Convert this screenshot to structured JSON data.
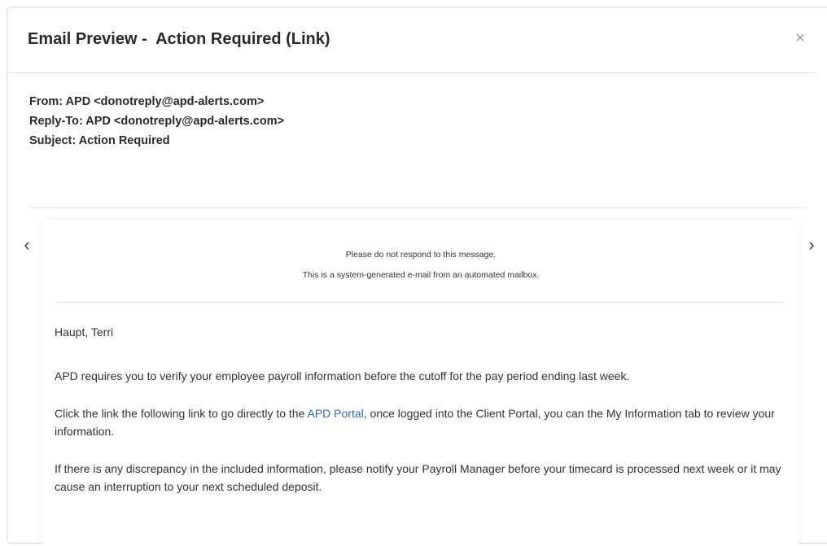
{
  "modal": {
    "title": "Email Preview -  Action Required (Link)",
    "close_glyph": "×"
  },
  "email_headers": {
    "from": "From: APD <donotreply@apd-alerts.com>",
    "reply_to": "Reply-To: APD <donotreply@apd-alerts.com>",
    "subject": "Subject: Action Required"
  },
  "navigation": {
    "prev_glyph": "‹",
    "next_glyph": "›"
  },
  "email_body": {
    "notice_1": "Please do not respond to this message.",
    "notice_2": "This is a system-generated e-mail from an automated mailbox.",
    "greeting": "Haupt, Terri",
    "paragraph_1": "APD requires you to verify your employee payroll information before the cutoff for the pay period ending last week.",
    "paragraph_2_before": "Click the link the following link to go directly to the ",
    "paragraph_2_link": "APD Portal",
    "paragraph_2_after": ", once logged into the Client Portal, you can the My Information tab to review your information.",
    "paragraph_3": "If there is any discrepancy in the included information, please notify your Payroll Manager before your timecard is processed next week or it may cause an interruption to your next scheduled deposit."
  },
  "colors": {
    "link": "#2c6fb5",
    "border": "#d9d9d9"
  },
  "icons": [
    "close-icon",
    "chevron-left-icon",
    "chevron-right-icon"
  ]
}
